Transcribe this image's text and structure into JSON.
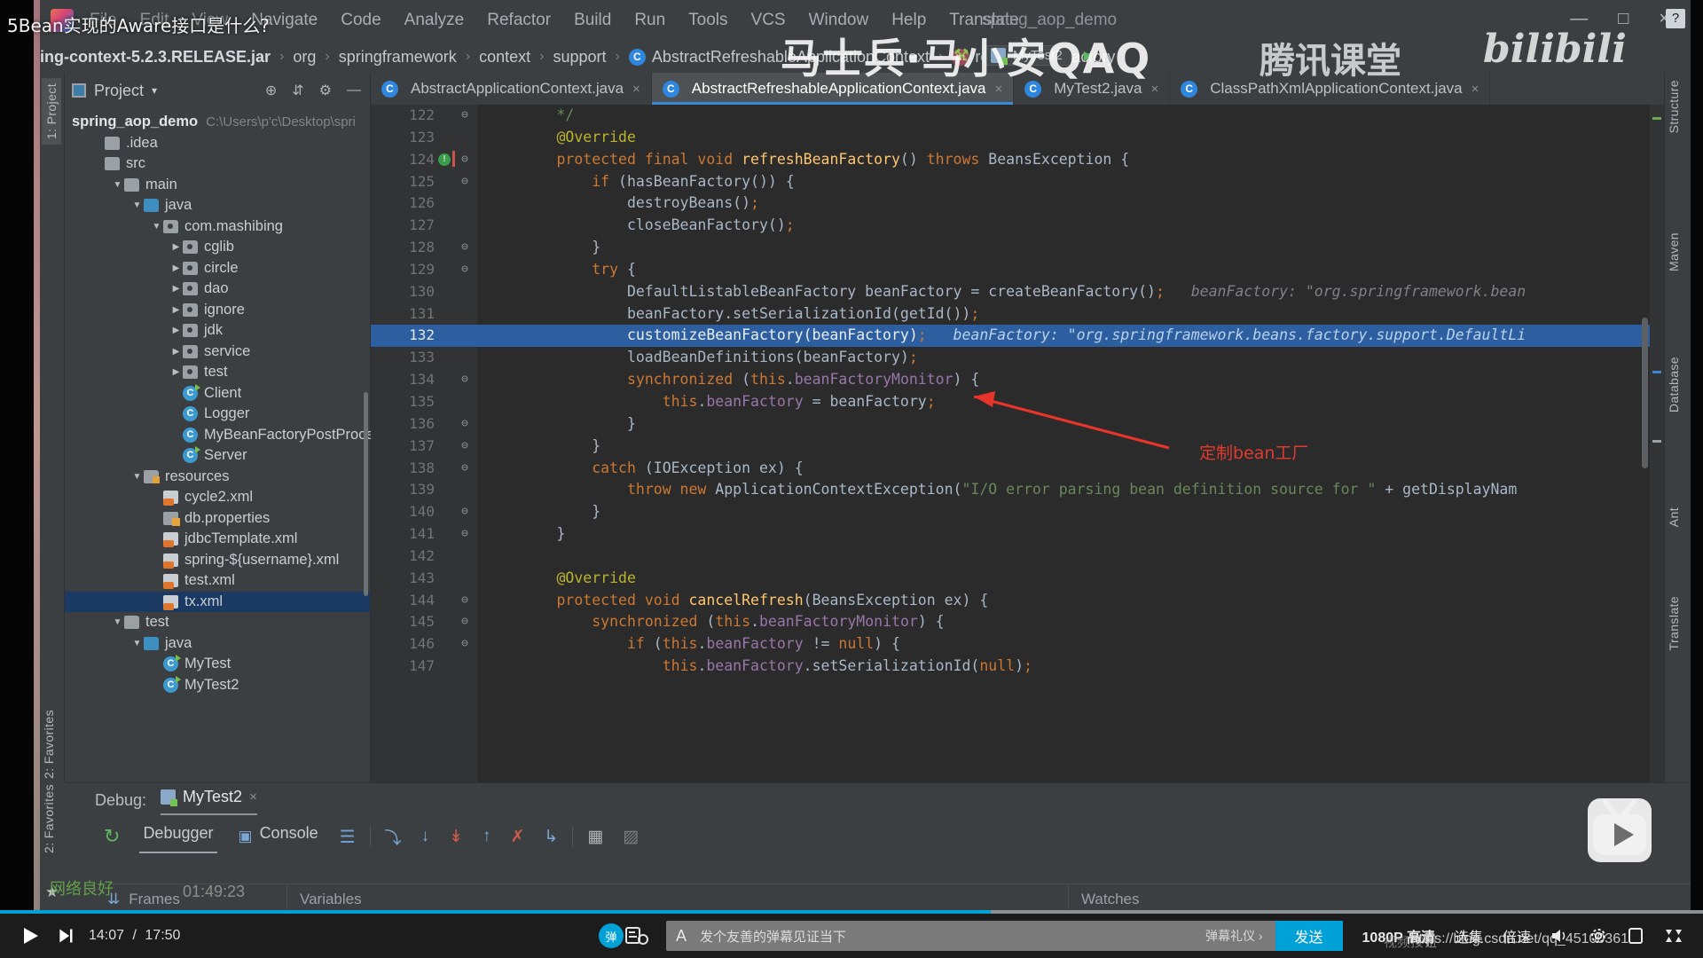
{
  "window": {
    "title": "spring_aop_demo",
    "minimize": "—",
    "maximize": "□",
    "close": "×",
    "help_badge": "?"
  },
  "menubar": {
    "items": [
      "File",
      "Edit",
      "View",
      "Navigate",
      "Code",
      "Analyze",
      "Refactor",
      "Build",
      "Run",
      "Tools",
      "VCS",
      "Window",
      "Help",
      "Translate"
    ]
  },
  "breadcrumb": {
    "items": [
      {
        "label": "ing-context-5.2.3.RELEASE.jar",
        "icon": ""
      },
      {
        "label": "org",
        "icon": ""
      },
      {
        "label": "springframework",
        "icon": ""
      },
      {
        "label": "context",
        "icon": ""
      },
      {
        "label": "support",
        "icon": ""
      },
      {
        "label": "AbstractRefreshableApplicationContext",
        "icon": "class-icon"
      },
      {
        "label": "refreshBeanFactory",
        "icon": "method-icon"
      }
    ],
    "separator": "›",
    "run_config": "MyTest2",
    "hammer": "⚒"
  },
  "left_tool_tabs": [
    "1: Project",
    "2: Favorites"
  ],
  "project_panel": {
    "title": "Project",
    "caret": "▾",
    "icons": [
      "locate-icon",
      "collapse-icon",
      "settings-icon",
      "hide-icon"
    ],
    "root": {
      "name": "spring_aop_demo",
      "path": "C:\\Users\\p'c\\Desktop\\spri"
    },
    "tree": [
      {
        "indent": 1,
        "arrow": "",
        "icon": "folder",
        "label": ".idea"
      },
      {
        "indent": 1,
        "arrow": "",
        "icon": "folder",
        "label": "src"
      },
      {
        "indent": 2,
        "arrow": "▼",
        "icon": "folder",
        "label": "main"
      },
      {
        "indent": 3,
        "arrow": "▼",
        "icon": "folder-blue",
        "label": "java"
      },
      {
        "indent": 4,
        "arrow": "▼",
        "icon": "package",
        "label": "com.mashibing"
      },
      {
        "indent": 5,
        "arrow": "▶",
        "icon": "package",
        "label": "cglib"
      },
      {
        "indent": 5,
        "arrow": "▶",
        "icon": "package",
        "label": "circle"
      },
      {
        "indent": 5,
        "arrow": "▶",
        "icon": "package",
        "label": "dao"
      },
      {
        "indent": 5,
        "arrow": "▶",
        "icon": "package",
        "label": "ignore"
      },
      {
        "indent": 5,
        "arrow": "▶",
        "icon": "package",
        "label": "jdk"
      },
      {
        "indent": 5,
        "arrow": "▶",
        "icon": "package",
        "label": "service"
      },
      {
        "indent": 5,
        "arrow": "▶",
        "icon": "package",
        "label": "test"
      },
      {
        "indent": 5,
        "arrow": "",
        "icon": "class-run",
        "label": "Client"
      },
      {
        "indent": 5,
        "arrow": "",
        "icon": "class",
        "label": "Logger"
      },
      {
        "indent": 5,
        "arrow": "",
        "icon": "class",
        "label": "MyBeanFactoryPostProcessor"
      },
      {
        "indent": 5,
        "arrow": "",
        "icon": "class-run",
        "label": "Server"
      },
      {
        "indent": 3,
        "arrow": "▼",
        "icon": "folder-res",
        "label": "resources"
      },
      {
        "indent": 4,
        "arrow": "",
        "icon": "xml",
        "label": "cycle2.xml"
      },
      {
        "indent": 4,
        "arrow": "",
        "icon": "properties",
        "label": "db.properties"
      },
      {
        "indent": 4,
        "arrow": "",
        "icon": "xml",
        "label": "jdbcTemplate.xml"
      },
      {
        "indent": 4,
        "arrow": "",
        "icon": "xml",
        "label": "spring-${username}.xml"
      },
      {
        "indent": 4,
        "arrow": "",
        "icon": "xml",
        "label": "test.xml"
      },
      {
        "indent": 4,
        "arrow": "",
        "icon": "xml",
        "label": "tx.xml",
        "selected": true
      },
      {
        "indent": 2,
        "arrow": "▼",
        "icon": "folder",
        "label": "test"
      },
      {
        "indent": 3,
        "arrow": "▼",
        "icon": "folder-blue",
        "label": "java"
      },
      {
        "indent": 4,
        "arrow": "",
        "icon": "class-run",
        "label": "MyTest"
      },
      {
        "indent": 4,
        "arrow": "",
        "icon": "class-run",
        "label": "MyTest2"
      }
    ]
  },
  "editor_tabs": [
    {
      "label": "AbstractApplicationContext.java",
      "active": false,
      "close": "×"
    },
    {
      "label": "AbstractRefreshableApplicationContext.java",
      "active": true,
      "close": "×"
    },
    {
      "label": "MyTest2.java",
      "active": false,
      "close": "×"
    },
    {
      "label": "ClassPathXmlApplicationContext.java",
      "active": false,
      "close": "×"
    }
  ],
  "code": {
    "first_line_number": 122,
    "highlighted_line": 132,
    "breakpoint_line": 124,
    "lines": [
      {
        "n": 122,
        "fold": "⊖",
        "html": "        <span class='str'>*/</span>"
      },
      {
        "n": 123,
        "fold": "",
        "html": "        <span class='ann'>@Override</span>"
      },
      {
        "n": 124,
        "fold": "⊖",
        "html": "        <span class='k'>protected final void</span> <span style='color:#ffc66d'>refreshBeanFactory</span>() <span class='k'>throws</span> BeansException {"
      },
      {
        "n": 125,
        "fold": "⊖",
        "html": "            <span class='k'>if</span> (hasBeanFactory()) {"
      },
      {
        "n": 126,
        "fold": "",
        "html": "                destroyBeans()<span class='semi'>;</span>"
      },
      {
        "n": 127,
        "fold": "",
        "html": "                closeBeanFactory()<span class='semi'>;</span>"
      },
      {
        "n": 128,
        "fold": "⊖",
        "html": "            }"
      },
      {
        "n": 129,
        "fold": "⊖",
        "html": "            <span class='k'>try</span> {"
      },
      {
        "n": 130,
        "fold": "",
        "html": "                DefaultListableBeanFactory beanFactory = createBeanFactory()<span class='semi'>;</span>   <span class='hint'>beanFactory: \"org.springframework.bean</span>"
      },
      {
        "n": 131,
        "fold": "",
        "html": "                beanFactory.setSerializationId(getId())<span class='semi'>;</span>"
      },
      {
        "n": 132,
        "fold": "",
        "html": "                customizeBeanFactory(beanFactory)<span class='semi'>;</span>   <span class='hintblue'>beanFactory: \"org.springframework.beans.factory.support.DefaultLi</span>"
      },
      {
        "n": 133,
        "fold": "",
        "html": "                loadBeanDefinitions(beanFactory)<span class='semi'>;</span>"
      },
      {
        "n": 134,
        "fold": "⊖",
        "html": "                <span class='k'>synchronized</span> (<span class='k'>this</span>.<span class='fld'>beanFactoryMonitor</span>) {"
      },
      {
        "n": 135,
        "fold": "",
        "html": "                    <span class='k'>this</span>.<span class='fld'>beanFactory</span> = beanFactory<span class='semi'>;</span>"
      },
      {
        "n": 136,
        "fold": "⊖",
        "html": "                }"
      },
      {
        "n": 137,
        "fold": "⊖",
        "html": "            }"
      },
      {
        "n": 138,
        "fold": "⊖",
        "html": "            <span class='k'>catch</span> (IOException ex) {"
      },
      {
        "n": 139,
        "fold": "",
        "html": "                <span class='k'>throw new</span> ApplicationContextException(<span class='str'>\"I/O error parsing bean definition source for \"</span> + getDisplayNam"
      },
      {
        "n": 140,
        "fold": "⊖",
        "html": "            }"
      },
      {
        "n": 141,
        "fold": "⊖",
        "html": "        }"
      },
      {
        "n": 142,
        "fold": "",
        "html": ""
      },
      {
        "n": 143,
        "fold": "",
        "html": "        <span class='ann'>@Override</span>"
      },
      {
        "n": 144,
        "fold": "⊖",
        "html": "        <span class='k'>protected void</span> <span style='color:#ffc66d'>cancelRefresh</span>(BeansException ex) {"
      },
      {
        "n": 145,
        "fold": "⊖",
        "html": "            <span class='k'>synchronized</span> (<span class='k'>this</span>.<span class='fld'>beanFactoryMonitor</span>) {"
      },
      {
        "n": 146,
        "fold": "⊖",
        "html": "                <span class='k'>if</span> (<span class='k'>this</span>.<span class='fld'>beanFactory</span> != <span class='k'>null</span>) {"
      },
      {
        "n": 147,
        "fold": "",
        "html": "                    <span class='k'>this</span>.<span class='fld'>beanFactory</span>.setSerializationId(<span class='k'>null</span>)<span class='semi'>;</span>"
      }
    ]
  },
  "annotation": {
    "text": "定制bean工厂",
    "color": "#e03b2f"
  },
  "right_tool_tabs": [
    "Structure",
    "Maven",
    "Database",
    "Ant",
    "Translate"
  ],
  "debug_panel": {
    "label": "Debug:",
    "tab": "MyTest2",
    "tab_close": "×",
    "rerun_icon": "rerun-icon",
    "sub_tabs": [
      "Debugger",
      "Console"
    ],
    "toolbar_icons": [
      "layout-icon",
      "step-over-icon",
      "step-into-icon",
      "force-step-into-icon",
      "step-out-icon",
      "drop-frame-icon",
      "run-to-cursor-icon",
      "evaluate-icon",
      "mute-icon"
    ],
    "columns": [
      "Frames",
      "Variables",
      "Watches"
    ]
  },
  "player": {
    "overlay_title": "5Bean实现的Aware接口是什么?",
    "watermark_center": "马士兵·马小安QAQ",
    "watermark_tencent": "腾讯课堂",
    "watermark_bili": "bilibili",
    "play_icon": "play-icon",
    "next_icon": "next-icon",
    "current_time": "14:07",
    "total_time": "17:50",
    "time_separator": "/",
    "danmaku_toggle": "弹",
    "danmaku_settings": "danmaku-settings-icon",
    "danmaku_A": "A",
    "danmaku_placeholder": "发个友善的弹幕见证当下",
    "danmaku_etiquette": "弹幕礼仪 ›",
    "send_label": "发送",
    "quality": "1080P 高清",
    "episodes": "选集",
    "speed": "倍速",
    "volume_icon": "volume-icon",
    "settings_icon": "settings-icon",
    "widescreen_icon": "widescreen-icon",
    "fullscreen_icon": "fullscreen-icon",
    "video_button": "视频按钮",
    "progress_percent": 58.2,
    "url_watermark": "https://blog.csdn.net/qq_45100361",
    "net_status": "网络良好",
    "clock": "01:49:23",
    "accent": "#00a1d6"
  }
}
